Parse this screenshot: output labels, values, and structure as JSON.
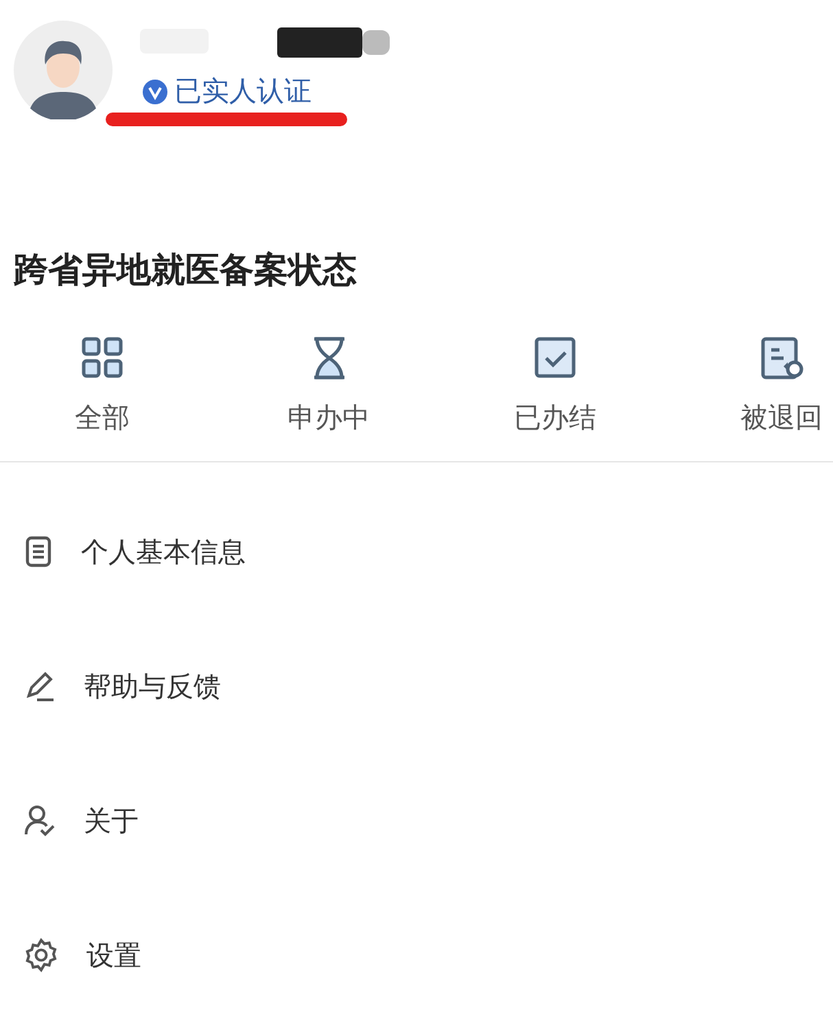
{
  "profile": {
    "verified_label": "已实人认证",
    "verified": true
  },
  "section_title": "跨省异地就医备案状态",
  "status_tabs": [
    {
      "label": "全部",
      "kind": "grid"
    },
    {
      "label": "申办中",
      "kind": "hourglass"
    },
    {
      "label": "已办结",
      "kind": "check"
    },
    {
      "label": "被退回",
      "kind": "returned"
    }
  ],
  "menu": [
    {
      "label": "个人基本信息",
      "kind": "document"
    },
    {
      "label": "帮助与反馈",
      "kind": "pen"
    },
    {
      "label": "关于",
      "kind": "person"
    },
    {
      "label": "设置",
      "kind": "gear"
    }
  ]
}
